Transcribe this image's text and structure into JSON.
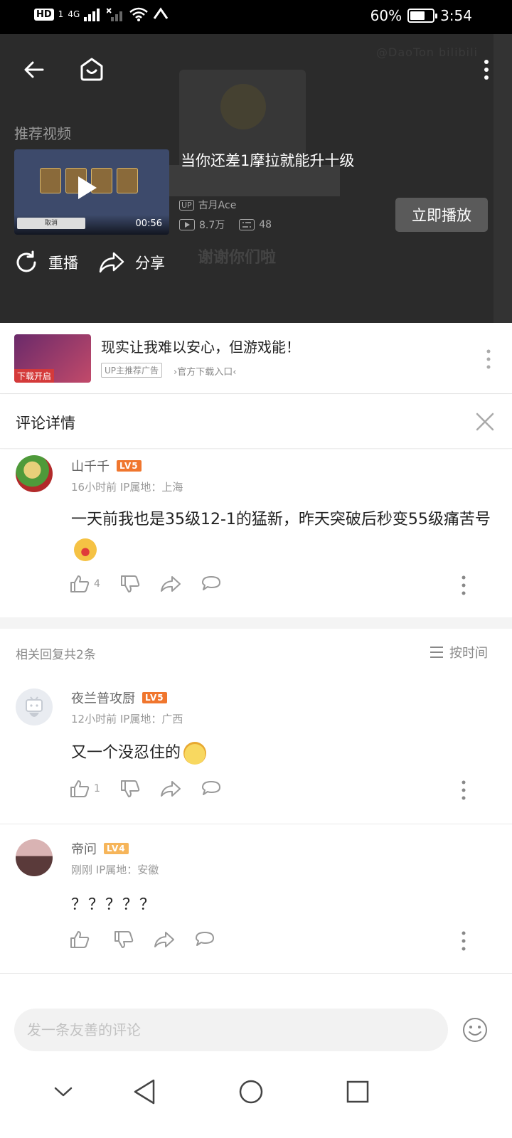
{
  "status_bar": {
    "hd": "HD",
    "sim": "1",
    "network": "4G",
    "battery_text": "60%",
    "battery_level": 0.6,
    "time": "3:54"
  },
  "player": {
    "watermark": "@DaoTon bilibili",
    "ghost_caption": "谢谢你们啦",
    "recommend_label": "推荐视频",
    "rec_title": "当你还差1摩拉就能升十级",
    "rec_up_badge": "UP",
    "rec_uploader": "古月Ace",
    "rec_views": "8.7万",
    "rec_danmaku": "48",
    "rec_duration": "00:56",
    "rec_cancel": "取消",
    "play_now": "立即播放",
    "replay": "重播",
    "share": "分享"
  },
  "ad": {
    "thumb_label": "下载开启",
    "title": "现实让我难以安心，但游戏能！",
    "tag": "UP主推荐广告",
    "link": "›官方下载入口‹"
  },
  "detail": {
    "title": "评论详情"
  },
  "main_comment": {
    "user": "山千千",
    "level": "LV5",
    "meta": "16小时前  IP属地：上海",
    "text": "一天前我也是35级12-1的猛新，昨天突破后秒变55级痛苦号",
    "likes": "4"
  },
  "replies": {
    "header": "相关回复共2条",
    "sort_label": "按时间",
    "items": [
      {
        "user": "夜兰普攻厨",
        "level": "LV5",
        "meta": "12小时前  IP属地：广西",
        "text": "又一个没忍住的",
        "likes": "1"
      },
      {
        "user": "帝问",
        "level": "LV4",
        "meta": "刚刚  IP属地：安徽",
        "text": "？？？？？",
        "likes": ""
      }
    ]
  },
  "input": {
    "placeholder": "发一条友善的评论"
  },
  "colors": {
    "level5": "#f0762e",
    "level4": "#f6b55a",
    "player_bg": "#2b2b2b",
    "text_gray": "#999999"
  }
}
